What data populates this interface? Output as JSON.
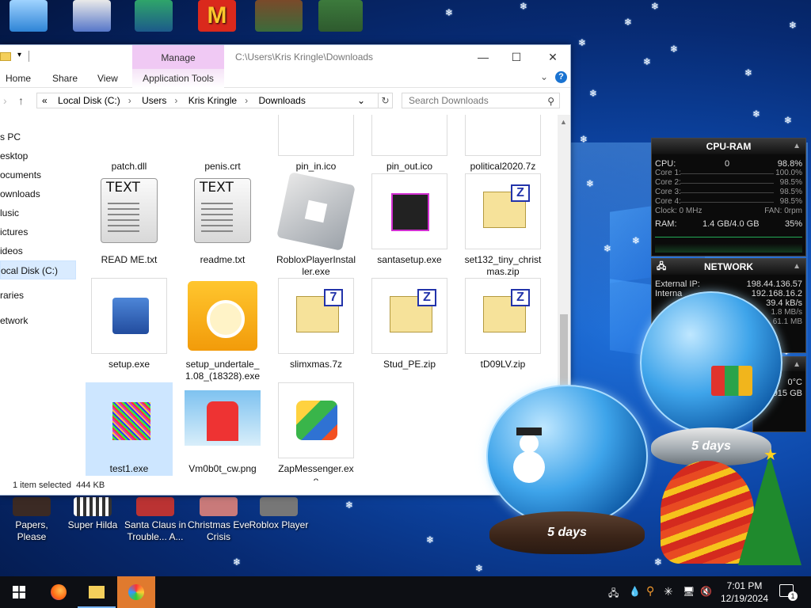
{
  "desktop": {
    "icons_bottom": [
      {
        "label": "Papers, Please",
        "id": "papers-please"
      },
      {
        "label": "Super Hilda",
        "id": "super-hilda"
      },
      {
        "label": "Santa Claus in Trouble... A...",
        "id": "santa-claus"
      },
      {
        "label": "Christmas Eve Crisis",
        "id": "christmas-eve-crisis"
      },
      {
        "label": "Roblox Player",
        "id": "roblox-player"
      }
    ]
  },
  "explorer": {
    "manage_tab": "Manage",
    "title_path": "C:\\Users\\Kris Kringle\\Downloads",
    "ribbon_tabs": [
      "Home",
      "Share",
      "View"
    ],
    "application_tools": "Application Tools",
    "address": {
      "prefix": "«",
      "crumbs": [
        "Local Disk (C:)",
        "Users",
        "Kris Kringle",
        "Downloads"
      ]
    },
    "search_placeholder": "Search Downloads",
    "nav_items": [
      "s PC",
      "esktop",
      "ocuments",
      "ownloads",
      "lusic",
      "ictures",
      "ideos",
      "ocal Disk (C:)",
      "raries",
      "etwork"
    ],
    "files": [
      {
        "name": "patch.dll",
        "icon": "dll-gear-icon"
      },
      {
        "name": "penis.crt",
        "icon": "certificate-icon"
      },
      {
        "name": "pin_in.ico",
        "icon": "ico-file-icon"
      },
      {
        "name": "pin_out.ico",
        "icon": "ico-file-icon"
      },
      {
        "name": "political2020.7z",
        "icon": "archive-icon"
      },
      {
        "name": "READ ME.txt",
        "icon": "text-file-icon"
      },
      {
        "name": "readme.txt",
        "icon": "text-file-icon"
      },
      {
        "name": "RobloxPlayerInstaller.exe",
        "icon": "roblox-icon"
      },
      {
        "name": "santasetup.exe",
        "icon": "santa-app-icon"
      },
      {
        "name": "set132_tiny_christmas.zip",
        "icon": "zip-icon"
      },
      {
        "name": "setup.exe",
        "icon": "installer-icon"
      },
      {
        "name": "setup_undertale_1.08_(18328).exe",
        "icon": "undertale-icon"
      },
      {
        "name": "slimxmas.7z",
        "icon": "7z-icon"
      },
      {
        "name": "Stud_PE.zip",
        "icon": "zip-icon"
      },
      {
        "name": "tD09LV.zip",
        "icon": "zip-icon"
      },
      {
        "name": "test1.exe",
        "icon": "noise-exe-icon"
      },
      {
        "name": "Vm0b0t_cw.png",
        "icon": "png-image-icon"
      },
      {
        "name": "ZapMessenger.exe",
        "icon": "zapmessenger-icon"
      }
    ],
    "status": "1 item selected  444 KB"
  },
  "cpu_ram": {
    "title": "CPU-RAM",
    "cpu_label": "CPU:",
    "cpu_mid": "0",
    "cpu_value": "98.8%",
    "cores": [
      {
        "label": "Core 1:",
        "value": "100.0%"
      },
      {
        "label": "Core 2:",
        "value": "98.5%"
      },
      {
        "label": "Core 3:",
        "value": "98.5%"
      },
      {
        "label": "Core 4:",
        "value": "98.5%"
      }
    ],
    "clock_label": "Clock: 0 MHz",
    "fan_label": "FAN: 0rpm",
    "ram_label": "RAM:",
    "ram_value": "1.4 GB/4.0 GB",
    "ram_pct": "35%"
  },
  "network": {
    "title": "NETWORK",
    "external_label": "External IP:",
    "external_ip": "198.44.136.57",
    "internal_label": "Interna",
    "internal_ip": "192.168.16.2",
    "row3": "39.4 kB/s",
    "row4": "1.8 MB/s",
    "row5": "61.1 MB"
  },
  "temp": {
    "value": "0°C",
    "storage": "915 GB"
  },
  "globes": [
    {
      "text": "5 days"
    },
    {
      "text": "5 days"
    }
  ],
  "taskbar": {
    "time": "7:01 PM",
    "date": "12/19/2024",
    "notification_count": "1",
    "colors": {
      "active": "#e07a2e",
      "bar": "#0d0f14"
    }
  }
}
